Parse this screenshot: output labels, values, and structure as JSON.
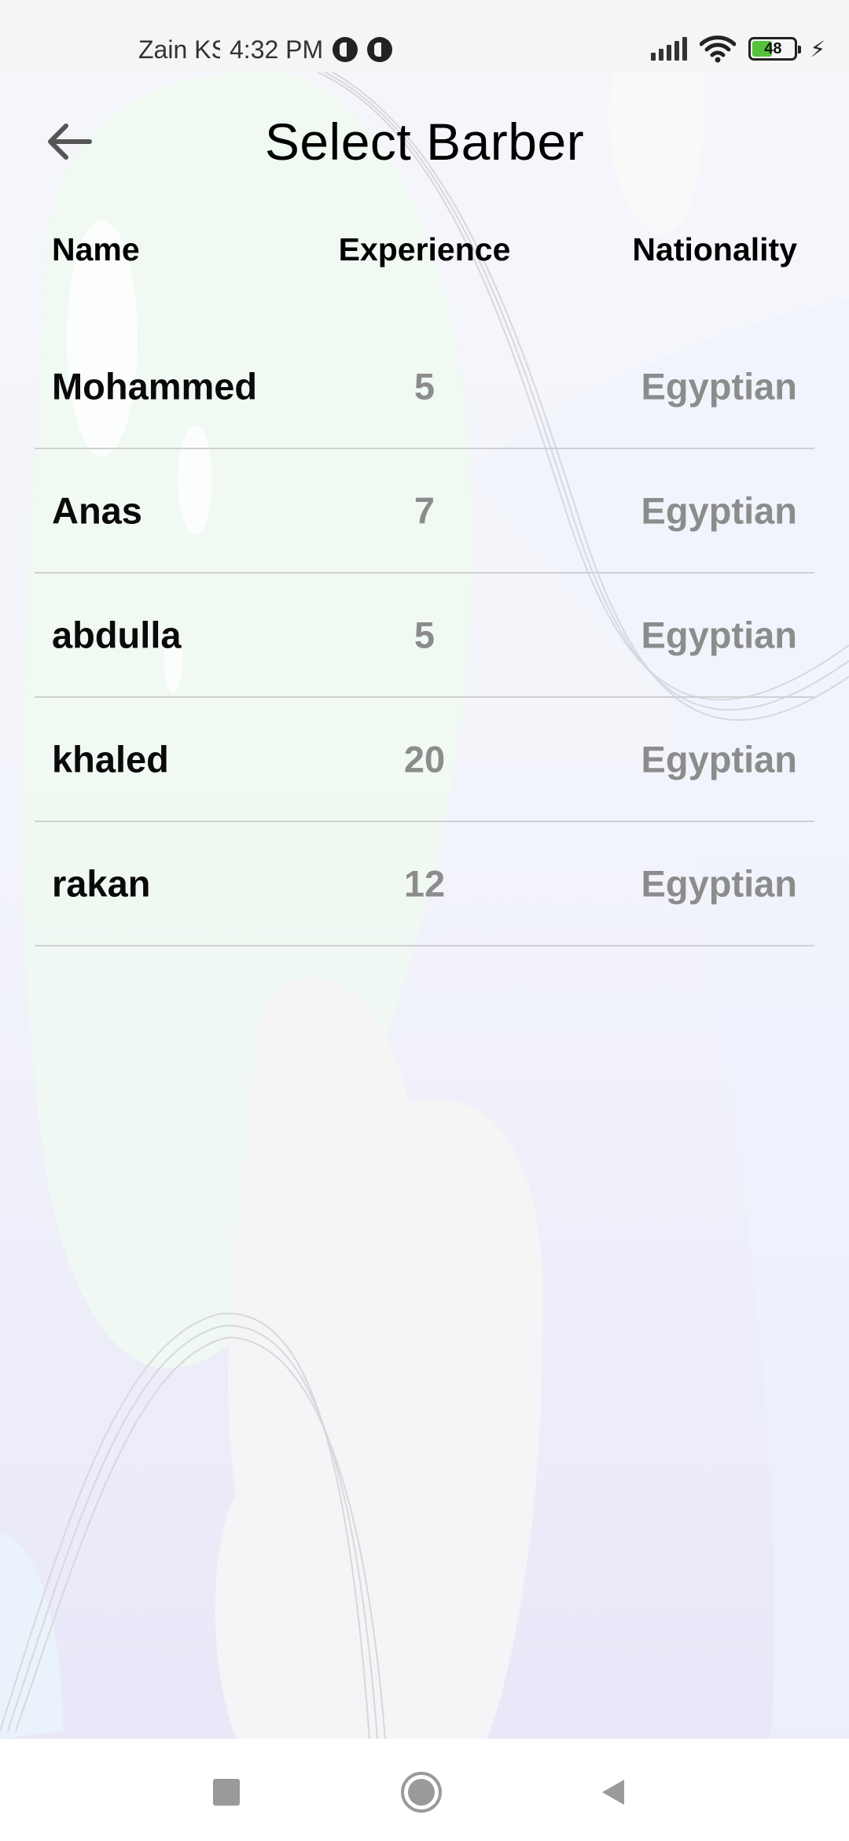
{
  "status_bar": {
    "carrier": "Zain KSA",
    "time": "4:32 PM",
    "battery": "48",
    "battery_level_percent": 48
  },
  "header": {
    "title": "Select Barber",
    "back_icon": "arrow-left-icon"
  },
  "table": {
    "headers": {
      "name": "Name",
      "experience": "Experience",
      "nationality": "Nationality"
    },
    "rows": [
      {
        "name": "Mohammed",
        "experience": "5",
        "nationality": "Egyptian"
      },
      {
        "name": "Anas",
        "experience": "7",
        "nationality": "Egyptian"
      },
      {
        "name": "abdulla",
        "experience": "5",
        "nationality": "Egyptian"
      },
      {
        "name": "khaled",
        "experience": "20",
        "nationality": "Egyptian"
      },
      {
        "name": "rakan",
        "experience": "12",
        "nationality": "Egyptian"
      }
    ]
  },
  "nav_bar": {
    "recent_icon": "square-icon",
    "home_icon": "circle-icon",
    "back_icon": "triangle-back-icon"
  },
  "colors": {
    "title": "#000000",
    "name_text": "#0a0a0a",
    "muted_text": "#8c8c8c",
    "divider": "#d0d0d2"
  }
}
